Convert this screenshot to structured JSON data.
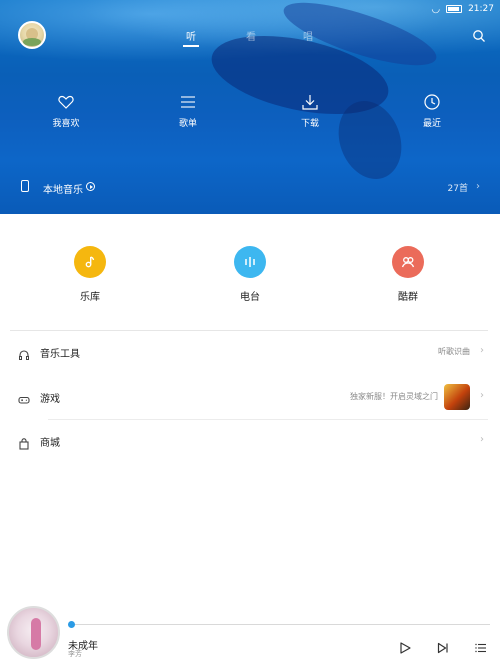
{
  "status_bar": {
    "time": "21:27"
  },
  "top_tabs": [
    "听",
    "看",
    "唱"
  ],
  "active_tab": "听",
  "quick_actions": [
    {
      "label": "我喜欢",
      "icon": "heart-icon"
    },
    {
      "label": "歌单",
      "icon": "list-icon"
    },
    {
      "label": "下载",
      "icon": "download-icon"
    },
    {
      "label": "最近",
      "icon": "clock-icon"
    }
  ],
  "local_music": {
    "label": "本地音乐",
    "count": "27首"
  },
  "features": [
    {
      "label": "乐库",
      "color": "#F5B70F",
      "icon": "music-note-icon"
    },
    {
      "label": "电台",
      "color": "#3DB7F0",
      "icon": "radio-bars-icon"
    },
    {
      "label": "酷群",
      "color": "#EB6B5A",
      "icon": "group-icon"
    }
  ],
  "menu": [
    {
      "label": "音乐工具",
      "hint": "听歌识曲",
      "icon": "headphones-icon"
    },
    {
      "label": "游戏",
      "hint": "独家新服！开启灵域之门",
      "icon": "gamepad-icon"
    },
    {
      "label": "商城",
      "hint": "",
      "icon": "shopping-bag-icon"
    }
  ],
  "player": {
    "title": "未成年",
    "artist": "李芳",
    "progress": 0.0
  },
  "colors": {
    "accent": "#2B9BE5",
    "hero_blue": "#0A5FB7"
  }
}
